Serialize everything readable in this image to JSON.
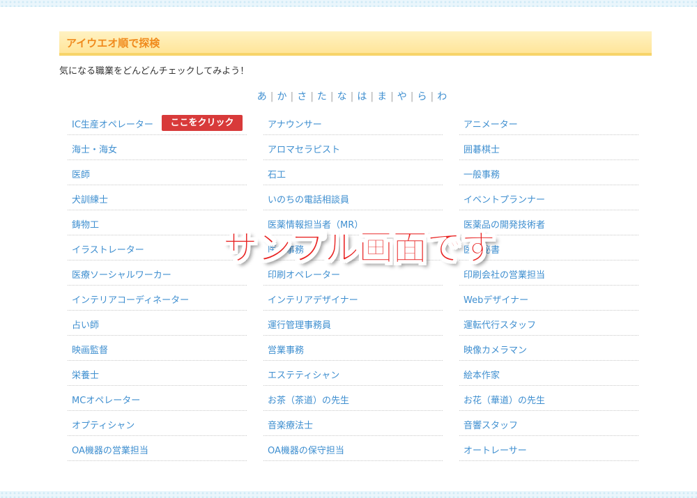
{
  "section": {
    "title": "アイウエオ順で探検",
    "intro": "気になる職業をどんどんチェックしてみよう！"
  },
  "kana_nav": [
    "あ",
    "か",
    "さ",
    "た",
    "な",
    "は",
    "ま",
    "や",
    "ら",
    "わ"
  ],
  "kana_separator": "|",
  "columns": [
    [
      "IC生産オペレーター",
      "海士・海女",
      "医師",
      "犬訓練士",
      "鋳物工",
      "イラストレーター",
      "医療ソーシャルワーカー",
      "インテリアコーディネーター",
      "占い師",
      "映画監督",
      "栄養士",
      "MCオペレーター",
      "オプティシャン",
      "OA機器の営業担当"
    ],
    [
      "アナウンサー",
      "アロマセラピスト",
      "石工",
      "いのちの電話相談員",
      "医薬情報担当者（MR）",
      "医療事務",
      "印刷オペレーター",
      "インテリアデザイナー",
      "運行管理事務員",
      "営業事務",
      "エステティシャン",
      "お茶（茶道）の先生",
      "音楽療法士",
      "OA機器の保守担当"
    ],
    [
      "アニメーター",
      "囲碁棋士",
      "一般事務",
      "イベントプランナー",
      "医薬品の開発技術者",
      "医療秘書",
      "印刷会社の営業担当",
      "Webデザイナー",
      "運転代行スタッフ",
      "映像カメラマン",
      "絵本作家",
      "お花（華道）の先生",
      "音響スタッフ",
      "オートレーサー"
    ]
  ],
  "click_badge": "ここをクリック",
  "overlay_text": "サンプル画面です",
  "colors": {
    "heading_text": "#f08a1c",
    "link": "#3f8fd0",
    "badge_bg": "#d83a3a",
    "overlay": "#e8201f"
  }
}
